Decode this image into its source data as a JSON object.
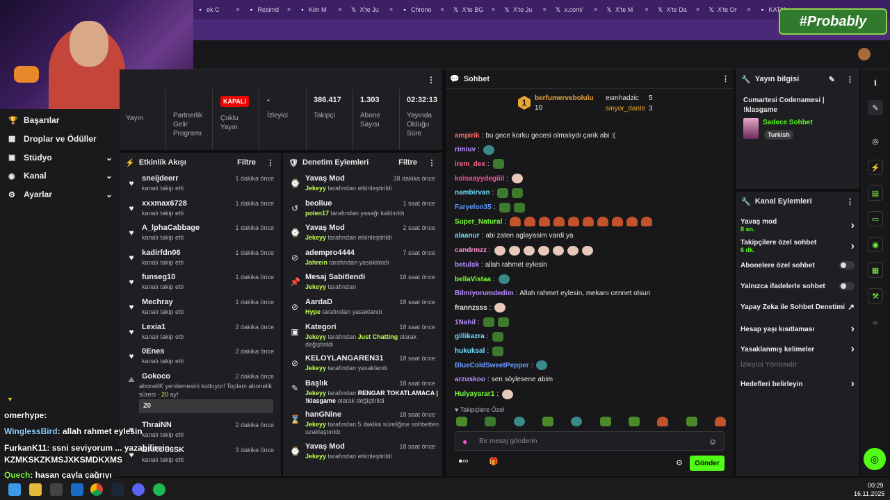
{
  "browser_tabs": [
    {
      "label": "ek C",
      "icon": "tab-icon"
    },
    {
      "label": "Resimd",
      "icon": "image-icon"
    },
    {
      "label": "Kim M",
      "icon": "tab-icon"
    },
    {
      "label": "X'te Ju",
      "icon": "x-icon"
    },
    {
      "label": "Chrono",
      "icon": "tab-icon"
    },
    {
      "label": "X'te BG",
      "icon": "x-icon"
    },
    {
      "label": "X'te Ju",
      "icon": "x-icon"
    },
    {
      "label": "x.com/",
      "icon": "x-icon"
    },
    {
      "label": "X'te M",
      "icon": "x-icon"
    },
    {
      "label": "X'te Da",
      "icon": "x-icon"
    },
    {
      "label": "X'te Or",
      "icon": "x-icon"
    },
    {
      "label": "KATM",
      "icon": "tab-icon"
    }
  ],
  "brand": {
    "text": "#Probably"
  },
  "sidebar": {
    "items": [
      {
        "label": "Başarılar",
        "icon": "trophy-icon",
        "chevron": false
      },
      {
        "label": "Droplar ve Ödüller",
        "icon": "gift-icon",
        "chevron": false
      },
      {
        "label": "Stüdyo",
        "icon": "studio-icon",
        "chevron": true
      },
      {
        "label": "Kanal",
        "icon": "channel-icon",
        "chevron": true
      },
      {
        "label": "Ayarlar",
        "icon": "gear-icon",
        "chevron": true
      }
    ]
  },
  "stats": {
    "yayin_label": "Yayın",
    "partner_label": "Partnerlik Gelir Programı",
    "multi_badge": "KAPALI",
    "multi_label": "Çoklu Yayın",
    "viewers_value": "-",
    "viewers_label": "İzleyici",
    "followers_value": "386.417",
    "followers_label": "Takipçi",
    "subs_value": "1.303",
    "subs_label": "Abone Sayısı",
    "time_value": "02:32:13",
    "time_label": "Yayında Olduğu Süre"
  },
  "activity": {
    "title": "Etkinlik Akışı",
    "filter": "Filtre",
    "rows": [
      {
        "name": "sneijdeerr",
        "sub": "kanalı takip etti",
        "time": "1 dakika önce"
      },
      {
        "name": "xxxmax6728",
        "sub": "kanalı takip etti",
        "time": "1 dakika önce"
      },
      {
        "name": "A_lphaCabbage",
        "sub": "kanalı takip etti",
        "time": "1 dakika önce"
      },
      {
        "name": "kadirfdn06",
        "sub": "kanalı takip etti",
        "time": "1 dakika önce"
      },
      {
        "name": "funseg10",
        "sub": "kanalı takip etti",
        "time": "1 dakika önce"
      },
      {
        "name": "Mechray",
        "sub": "kanalı takip etti",
        "time": "1 dakika önce"
      },
      {
        "name": "Lexia1",
        "sub": "kanalı takip etti",
        "time": "2 dakika önce"
      },
      {
        "name": "0Enes",
        "sub": "kanalı takip etti",
        "time": "2 dakika önce"
      }
    ],
    "gokoco": {
      "name": "Gokoco",
      "time": "2 dakika önce",
      "sub1": "aboneliK yenilemesini kutluyor! Toplam abonelik",
      "sub2_pre": "süresi - ",
      "sub2_val": "20",
      "sub2_post": " ay!",
      "box": "20"
    },
    "rows2": [
      {
        "name": "ThraiNN",
        "sub": "kanalı takip etti",
        "time": "2 dakika önce"
      },
      {
        "name": "BAROS6SK",
        "sub": "kanalı takip etti",
        "time": "3 dakika önce"
      }
    ]
  },
  "moderation": {
    "title": "Denetim Eylemleri",
    "filter": "Filtre",
    "rows": [
      {
        "name": "Yavaş Mod",
        "who": "Jekeyy",
        "sub": " tarafından etkinleştirildi",
        "time": "38 dakika önce",
        "icon": "slow-mode-icon"
      },
      {
        "name": "beoliue",
        "who": "polen17",
        "sub": " tarafından yasağı kaldırıldı",
        "time": "1 saat önce",
        "icon": "undo-icon"
      },
      {
        "name": "Yavaş Mod",
        "who": "Jekeyy",
        "sub": " tarafından etkinleştirildi",
        "time": "2 saat önce",
        "icon": "slow-mode-icon"
      },
      {
        "name": "adempro4444",
        "who": "Jahrein",
        "sub": " tarafından yasaklandı",
        "time": "7 saat önce",
        "icon": "ban-icon"
      },
      {
        "name": "Mesaj Sabitlendi",
        "who": "Jekeyy",
        "sub": " tarafından",
        "time": "18 saat önce",
        "icon": "pin-icon"
      },
      {
        "name": "AardaD",
        "who": "Hype",
        "sub": " tarafından yasaklandı",
        "time": "18 saat önce",
        "icon": "ban-icon"
      }
    ],
    "kategori": {
      "name": "Kategori",
      "who": "Jekeyy",
      "mid": " tarafından ",
      "val": "Just Chatting",
      "post": " olarak",
      "line2": "değiştirildi",
      "time": "18 saat önce"
    },
    "rows2": [
      {
        "name": "KELOYLANGAREN31",
        "who": "Jekeyy",
        "sub": " tarafından yasaklandı",
        "time": "18 saat önce",
        "icon": "ban-icon"
      }
    ],
    "baslik": {
      "name": "Başlık",
      "who": "Jekeyy",
      "mid": " tarafından ",
      "val": "RENGAR TOKATLAMACA |",
      "line2_val": "!klasgame",
      "line2_post": " olarak değiştirildi",
      "time": "18 saat önce"
    },
    "hangnine": {
      "name": "hanGNine",
      "who": "Jekeyy",
      "sub": " tarafından 5 dakika süreliğine sohbetten",
      "line2": "uzaklaştırıldı",
      "time": "18 saat önce"
    },
    "last": {
      "name": "Yavaş Mod",
      "who": "Jekeyy",
      "sub": " tarafından etkinleştirildi",
      "time": "18 saat önce"
    }
  },
  "chat": {
    "title": "Sohbet",
    "leader": {
      "rank": "1",
      "name": "berfumervebolulu",
      "count": "10",
      "p2": "esmhadzic",
      "p2c": "5",
      "p3": "sinyor_dante",
      "p3c": "3"
    },
    "messages": [
      {
        "user": "ampirik",
        "color": "#ff6b6b",
        "text": " bu gece korku gecesi olmalıydı çarık abi :(",
        "emotes": ""
      },
      {
        "user": "rimiuv",
        "color": "#b98cff",
        "text": "",
        "emotes": "b"
      },
      {
        "user": "irem_dex",
        "color": "#ff6b8b",
        "text": "",
        "emotes": "g"
      },
      {
        "user": "kolsaayydegiiil",
        "color": "#ff4f9f",
        "text": "",
        "emotes": "p"
      },
      {
        "user": "nambirvan",
        "color": "#6fdcff",
        "text": "",
        "emotes": "gg"
      },
      {
        "user": "Faryelon35",
        "color": "#5a9bff",
        "text": "",
        "emotes": "gg"
      },
      {
        "user": "Super_Natural",
        "color": "#7cfc3c",
        "text": "",
        "emotes": "ffffffffff"
      },
      {
        "user": "alaanur",
        "color": "#6fdcff",
        "text": " abi zaten aglayasim vardi ya",
        "emotes": ""
      },
      {
        "user": "candrmzz",
        "color": "#ff8fd0",
        "text": "",
        "emotes": "ppppppp"
      },
      {
        "user": "betulsk",
        "color": "#b98cff",
        "text": " allah rahmet eylesin",
        "emotes": ""
      },
      {
        "user": "bellaVistaa",
        "color": "#7cfc3c",
        "text": "",
        "emotes": "b"
      },
      {
        "user": "Bilmiyorumdedim",
        "color": "#b98cff",
        "text": " Allah rahmet eylesin, mekanı cennet olsun",
        "emotes": ""
      },
      {
        "user": "frannzsss",
        "color": "#e8e8e8",
        "text": "",
        "emotes": "p"
      },
      {
        "user": "1Nahil",
        "color": "#b98cff",
        "text": "",
        "emotes": "gg"
      },
      {
        "user": "gillikazra",
        "color": "#6fdcff",
        "text": "",
        "emotes": "g"
      },
      {
        "user": "hukuksal",
        "color": "#6fdcff",
        "text": "",
        "emotes": "g"
      },
      {
        "user": "BlueColdSweetPepper",
        "color": "#6f9cff",
        "text": "",
        "emotes": "b"
      },
      {
        "user": "arzuskoo",
        "color": "#b98cff",
        "text": " sen söylesene abim",
        "emotes": ""
      },
      {
        "user": "Hulyayarar1",
        "color": "#7cfc3c",
        "text": "",
        "emotes": "p"
      }
    ],
    "followers_only": "Takipçilere Özel",
    "placeholder": "Bir mesaj gönderin",
    "send": "Gönder"
  },
  "info": {
    "title": "Yayın bilgisi",
    "stream_title": "Cumartesi Codenamesi | !klasgame",
    "category": "Sadece Sohbet",
    "lang_tag": "Turkish"
  },
  "actions": {
    "title": "Kanal Eylemleri",
    "items": [
      {
        "label": "Yavaş mod",
        "sub": "8 sn.",
        "kind": "chevron"
      },
      {
        "label": "Takipçilere özel sohbet",
        "sub": "6 dk.",
        "kind": "chevron"
      },
      {
        "label": "Abonelere özel sohbet",
        "sub": "",
        "kind": "toggle"
      },
      {
        "label": "Yalnızca ifadelerle sohbet",
        "sub": "",
        "kind": "toggle"
      },
      {
        "label": "Yapay Zeka ile Sohbet Denetimi",
        "sub": "",
        "kind": "external"
      },
      {
        "label": "Hesap yaşı kısıtlaması",
        "sub": "",
        "kind": "chevron"
      },
      {
        "label": "Yasaklanmış kelimeler",
        "sub": "",
        "kind": "chevron"
      },
      {
        "label": "İzleyici Yönlendir",
        "sub": "",
        "kind": "disabled"
      },
      {
        "label": "Hedefleri belirleyin",
        "sub": "",
        "kind": "chevron"
      }
    ]
  },
  "overlay_chat": [
    {
      "user": "omerhype",
      "text": ":"
    },
    {
      "user": "WinglessBird",
      "text": ": allah rahmet eylesin"
    },
    {
      "user": "FurkanK11",
      "text": ": ssni seviyorum ... yazabilirsin"
    },
    {
      "user": "",
      "text": "KZMKSKZKMSJXKSMDKXMS"
    },
    {
      "user": "Quech",
      "text": ": hasan çayla çağrıyı"
    }
  ],
  "taskbar": {
    "time": "00:29",
    "date": "16.11.2025"
  },
  "colors": {
    "accent": "#53fc18",
    "panel": "#1f1f23",
    "bg": "#0e0e0e"
  }
}
